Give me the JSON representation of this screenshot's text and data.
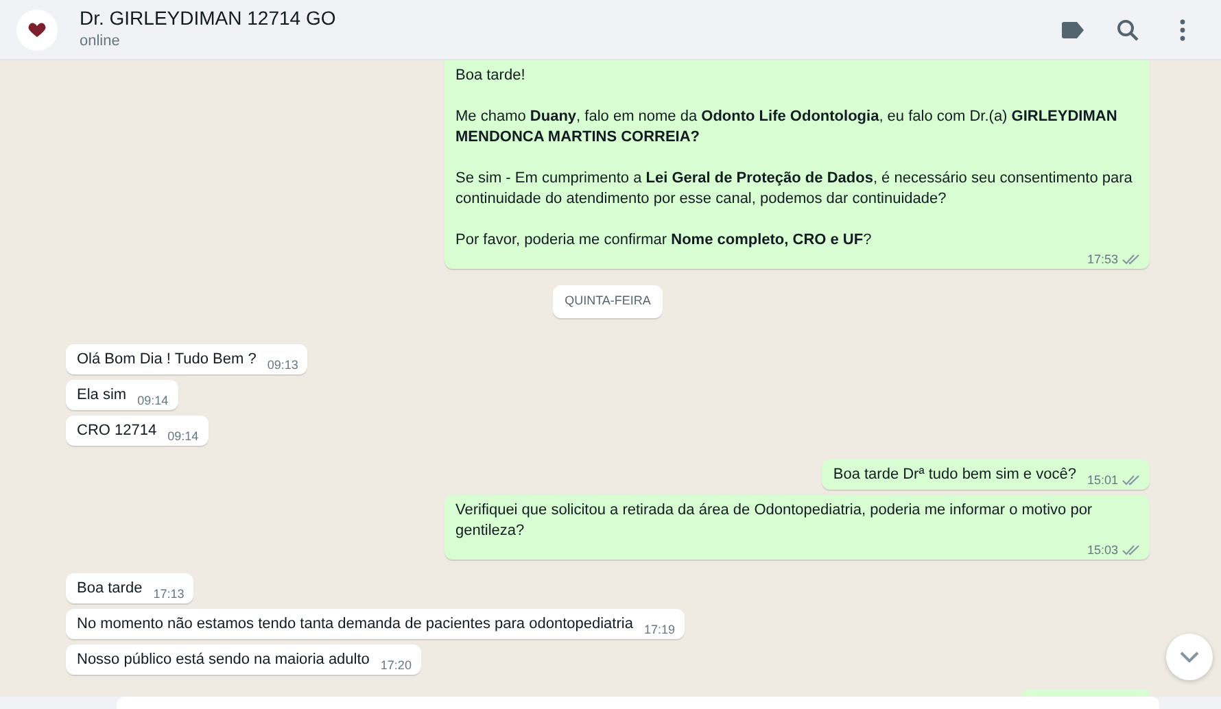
{
  "header": {
    "title": "Dr. GIRLEYDIMAN 12714 GO",
    "status": "online"
  },
  "messages": [
    {
      "kind": "message",
      "outgoing": true,
      "paragraphs": [
        "Boa tarde!",
        "Me chamo **Duany**, falo em nome da **Odonto Life Odontologia**, eu falo com Dr.(a) **GIRLEYDIMAN MENDONCA MARTINS CORREIA?**",
        "Se sim - Em cumprimento a **Lei Geral de Proteção de Dados**, é necessário seu consentimento para continuidade do atendimento por esse canal, podemos dar continuidade?",
        "Por favor, poderia me confirmar **Nome completo, CRO e UF**?"
      ],
      "time": "17:53",
      "read": false
    },
    {
      "kind": "date",
      "text": "QUINTA-FEIRA"
    },
    {
      "kind": "message",
      "outgoing": false,
      "paragraphs": [
        "Olá Bom Dia ! Tudo Bem ?"
      ],
      "time": "09:13"
    },
    {
      "kind": "message",
      "outgoing": false,
      "paragraphs": [
        "Ela sim"
      ],
      "time": "09:14"
    },
    {
      "kind": "message",
      "outgoing": false,
      "paragraphs": [
        "CRO 12714"
      ],
      "time": "09:14"
    },
    {
      "kind": "message",
      "outgoing": true,
      "paragraphs": [
        "Boa tarde Drª tudo bem sim e você?"
      ],
      "time": "15:01",
      "read": false
    },
    {
      "kind": "message",
      "outgoing": true,
      "paragraphs": [
        "Verifiquei que solicitou a retirada da área de Odontopediatria, poderia me informar o motivo por gentileza?"
      ],
      "time": "15:03",
      "read": false
    },
    {
      "kind": "message",
      "outgoing": false,
      "paragraphs": [
        "Boa tarde"
      ],
      "time": "17:13"
    },
    {
      "kind": "message",
      "outgoing": false,
      "paragraphs": [
        "No momento não estamos tendo tanta demanda de pacientes para odontopediatria"
      ],
      "time": "17:19"
    },
    {
      "kind": "message",
      "outgoing": false,
      "paragraphs": [
        "Nosso público está sendo na maioria adulto"
      ],
      "time": "17:20"
    },
    {
      "kind": "partial",
      "outgoing": true
    }
  ]
}
